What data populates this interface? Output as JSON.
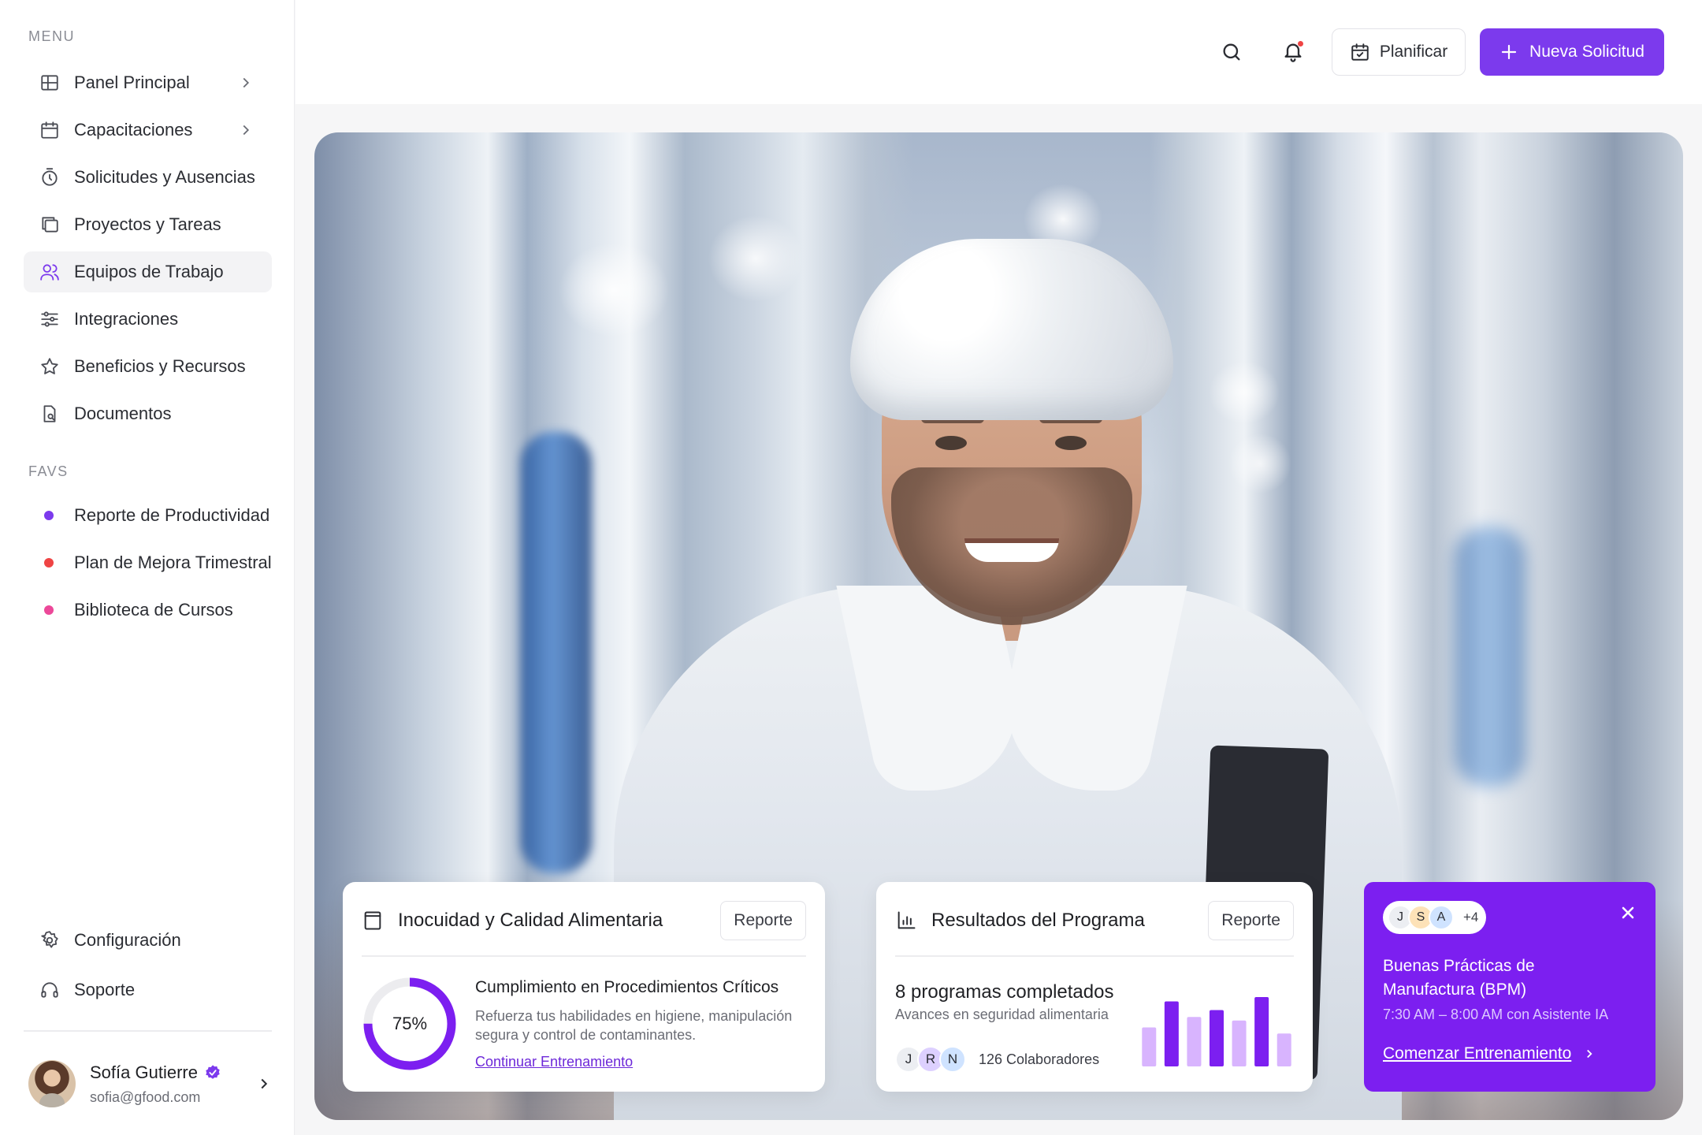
{
  "colors": {
    "accent": "#7c3aed",
    "promo_bg": "#7c1ff0",
    "dot_purple": "#7c3aed",
    "dot_red": "#ef4444",
    "dot_pink": "#ec4899"
  },
  "sidebar": {
    "menu_label": "MENU",
    "items": [
      {
        "label": "Panel Principal",
        "icon": "grid-icon",
        "has_chevron": true
      },
      {
        "label": "Capacitaciones",
        "icon": "calendar-icon",
        "has_chevron": true
      },
      {
        "label": "Solicitudes y Ausencias",
        "icon": "timer-icon"
      },
      {
        "label": "Proyectos y Tareas",
        "icon": "folders-icon"
      },
      {
        "label": "Equipos de Trabajo",
        "icon": "users-icon",
        "active": true
      },
      {
        "label": "Integraciones",
        "icon": "sliders-icon"
      },
      {
        "label": "Beneficios y Recursos",
        "icon": "star-icon"
      },
      {
        "label": "Documentos",
        "icon": "document-search-icon"
      }
    ],
    "favs_label": "FAVS",
    "favs": [
      {
        "label": "Reporte de Productividad",
        "color": "#7c3aed"
      },
      {
        "label": "Plan de Mejora Trimestral",
        "color": "#ef4444"
      },
      {
        "label": "Biblioteca de Cursos",
        "color": "#ec4899"
      }
    ],
    "bottom": [
      {
        "label": "Configuración",
        "icon": "gear-icon"
      },
      {
        "label": "Soporte",
        "icon": "headset-icon"
      }
    ],
    "profile": {
      "name": "Sofía Gutierre",
      "email": "sofia@gfood.com"
    }
  },
  "topbar": {
    "plan_label": "Planificar",
    "new_request_label": "Nueva Solicitud"
  },
  "card_safety": {
    "title": "Inocuidad y Calidad Alimentaria",
    "button": "Reporte",
    "progress": 75,
    "progress_label": "75%",
    "heading": "Cumplimiento en Procedimientos Críticos",
    "description": "Refuerza tus habilidades en higiene, manipulación segura y control de contaminantes.",
    "link": "Continuar Entrenamiento"
  },
  "card_results": {
    "title": "Resultados del Programa",
    "button": "Reporte",
    "headline": "8 programas completados",
    "subline": "Avances en seguridad alimentaria",
    "avatars": [
      "J",
      "R",
      "N"
    ],
    "people_count": "126 Colaboradores",
    "chart_data": {
      "type": "bar",
      "values": [
        45,
        75,
        57,
        65,
        53,
        80,
        38
      ],
      "colors": [
        "#d8b4fe",
        "#7c1ff0",
        "#d8b4fe",
        "#7c1ff0",
        "#d8b4fe",
        "#7c1ff0",
        "#d8b4fe"
      ],
      "ylim": [
        0,
        100
      ]
    }
  },
  "promo": {
    "avatars": [
      "J",
      "S",
      "A"
    ],
    "more": "+4",
    "title": "Buenas Prácticas de Manufactura (BPM)",
    "time": "7:30 AM – 8:00 AM con Asistente IA",
    "link": "Comenzar Entrenamiento"
  }
}
